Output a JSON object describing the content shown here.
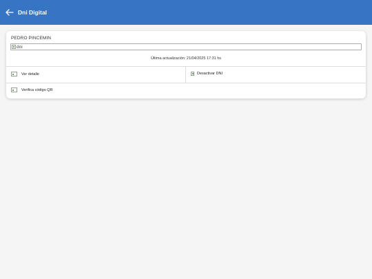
{
  "header": {
    "title": "Dni Digital",
    "back_icon": "arrow-left-icon",
    "background": "#3874c4"
  },
  "card": {
    "holder_name": "PEDRO PINCEMIN",
    "dni_image_alt": "dni",
    "last_update": "Última actualización: 21/04/2025 17:31 hs",
    "actions": {
      "view_details": "Ver detalle",
      "deactivate": "Desactivar DNI",
      "verify_qr": "Verifica código QR"
    }
  }
}
